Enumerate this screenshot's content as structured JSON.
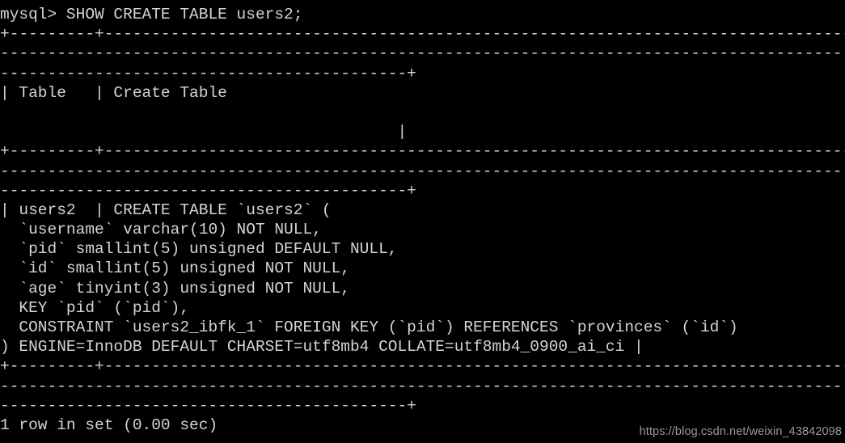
{
  "terminal": {
    "prompt_line": "mysql> SHOW CREATE TABLE users2;",
    "lines": [
      "mysql> SHOW CREATE TABLE users2;",
      "+---------+----------------------------------------------------------------------------------",
      "-----------------------------------------------------------------------------------------",
      "-------------------------------------------+",
      "| Table   | Create Table",
      "",
      "                                          |",
      "+---------+----------------------------------------------------------------------------------",
      "-----------------------------------------------------------------------------------------",
      "-------------------------------------------+",
      "| users2  | CREATE TABLE `users2` (",
      "  `username` varchar(10) NOT NULL,",
      "  `pid` smallint(5) unsigned DEFAULT NULL,",
      "  `id` smallint(5) unsigned NOT NULL,",
      "  `age` tinyint(3) unsigned NOT NULL,",
      "  KEY `pid` (`pid`),",
      "  CONSTRAINT `users2_ibfk_1` FOREIGN KEY (`pid`) REFERENCES `provinces` (`id`)",
      ") ENGINE=InnoDB DEFAULT CHARSET=utf8mb4 COLLATE=utf8mb4_0900_ai_ci |",
      "+---------+----------------------------------------------------------------------------------",
      "-----------------------------------------------------------------------------------------",
      "-------------------------------------------+",
      "1 row in set (0.00 sec)"
    ],
    "sql_command": "SHOW CREATE TABLE users2;",
    "table_name": "users2",
    "column_headers": [
      "Table",
      "Create Table"
    ],
    "create_table_statement": {
      "header": "CREATE TABLE `users2` (",
      "columns": [
        "`username` varchar(10) NOT NULL,",
        "`pid` smallint(5) unsigned DEFAULT NULL,",
        "`id` smallint(5) unsigned NOT NULL,",
        "`age` tinyint(3) unsigned NOT NULL,"
      ],
      "keys": [
        "KEY `pid` (`pid`),",
        "CONSTRAINT `users2_ibfk_1` FOREIGN KEY (`pid`) REFERENCES `provinces` (`id`)"
      ],
      "footer": ") ENGINE=InnoDB DEFAULT CHARSET=utf8mb4 COLLATE=utf8mb4_0900_ai_ci",
      "engine": "InnoDB",
      "charset": "utf8mb4",
      "collation": "utf8mb4_0900_ai_ci"
    },
    "status_line": "1 row in set (0.00 sec)",
    "row_count": "1 row",
    "elapsed": "0.00 sec"
  },
  "watermark": {
    "text": "https://blog.csdn.net/weixin_43842098"
  },
  "colors": {
    "background": "#000000",
    "foreground": "#d4d4d4",
    "watermark": "#9a9a9a"
  }
}
